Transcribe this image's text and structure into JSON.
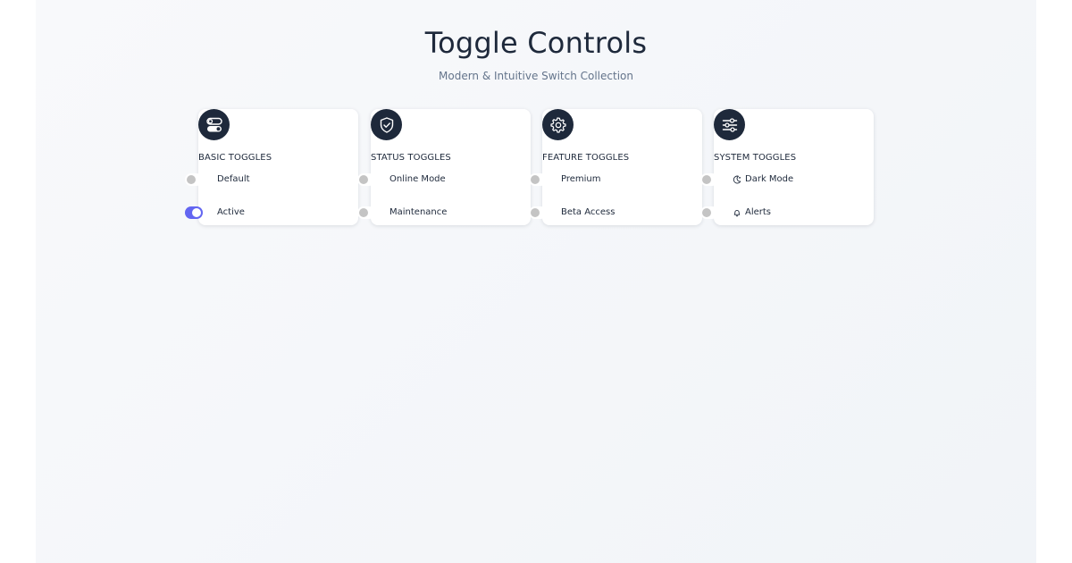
{
  "header": {
    "title": "Toggle Controls",
    "subtitle": "Modern & Intuitive Switch Collection"
  },
  "colors": {
    "accent": "#6366f1",
    "icon_bg": "#1e293b",
    "text": "#1e293b",
    "muted": "#64748b",
    "knob_off": "#c4c4c4"
  },
  "cards": [
    {
      "title": "BASIC TOGGLES",
      "icon": "toggles-icon",
      "toggles": [
        {
          "label": "Default",
          "on": false,
          "icon": null
        },
        {
          "label": "Active",
          "on": true,
          "icon": null
        }
      ]
    },
    {
      "title": "STATUS TOGGLES",
      "icon": "shield-check-icon",
      "toggles": [
        {
          "label": "Online Mode",
          "on": false,
          "icon": null
        },
        {
          "label": "Maintenance",
          "on": false,
          "icon": null
        }
      ]
    },
    {
      "title": "FEATURE TOGGLES",
      "icon": "gear-icon",
      "toggles": [
        {
          "label": "Premium",
          "on": false,
          "icon": null
        },
        {
          "label": "Beta Access",
          "on": false,
          "icon": null
        }
      ]
    },
    {
      "title": "SYSTEM TOGGLES",
      "icon": "sliders-icon",
      "toggles": [
        {
          "label": "Dark Mode",
          "on": false,
          "icon": "moon-icon"
        },
        {
          "label": "Alerts",
          "on": false,
          "icon": "bell-icon"
        }
      ]
    }
  ]
}
